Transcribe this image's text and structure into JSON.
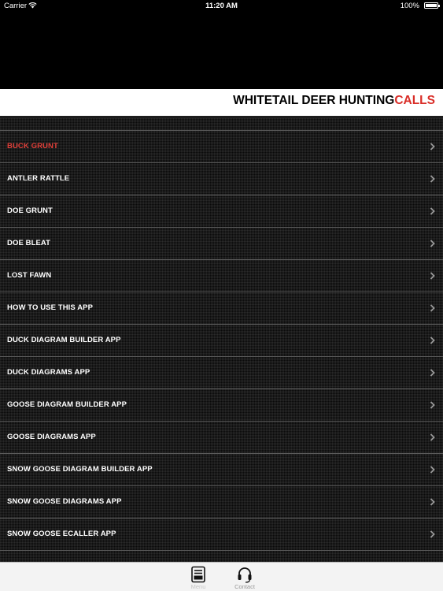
{
  "status_bar": {
    "carrier": "Carrier",
    "time": "11:20 AM",
    "battery": "100%"
  },
  "header": {
    "title_main": "WHITETAIL DEER HUNTING",
    "title_accent": "CALLS",
    "accent_color": "#d92d27"
  },
  "menu": {
    "items": [
      {
        "label": "BUCK GRUNT",
        "active": true
      },
      {
        "label": "ANTLER RATTLE"
      },
      {
        "label": "DOE GRUNT"
      },
      {
        "label": "DOE BLEAT"
      },
      {
        "label": "LOST FAWN"
      },
      {
        "label": "HOW TO USE THIS APP"
      },
      {
        "label": "DUCK DIAGRAM BUILDER APP"
      },
      {
        "label": "DUCK DIAGRAMS APP"
      },
      {
        "label": "GOOSE DIAGRAM BUILDER APP"
      },
      {
        "label": "GOOSE DIAGRAMS APP"
      },
      {
        "label": "SNOW GOOSE DIAGRAM BUILDER APP"
      },
      {
        "label": "SNOW GOOSE DIAGRAMS APP"
      },
      {
        "label": "SNOW GOOSE ECALLER APP"
      },
      {
        "label": ""
      }
    ],
    "chevron_icon": "chevron-right-icon"
  },
  "tab_bar": {
    "tabs": [
      {
        "label": "Menu",
        "icon": "menu-list-icon",
        "selected": true
      },
      {
        "label": "Contact",
        "icon": "headset-icon",
        "selected": false
      }
    ]
  }
}
